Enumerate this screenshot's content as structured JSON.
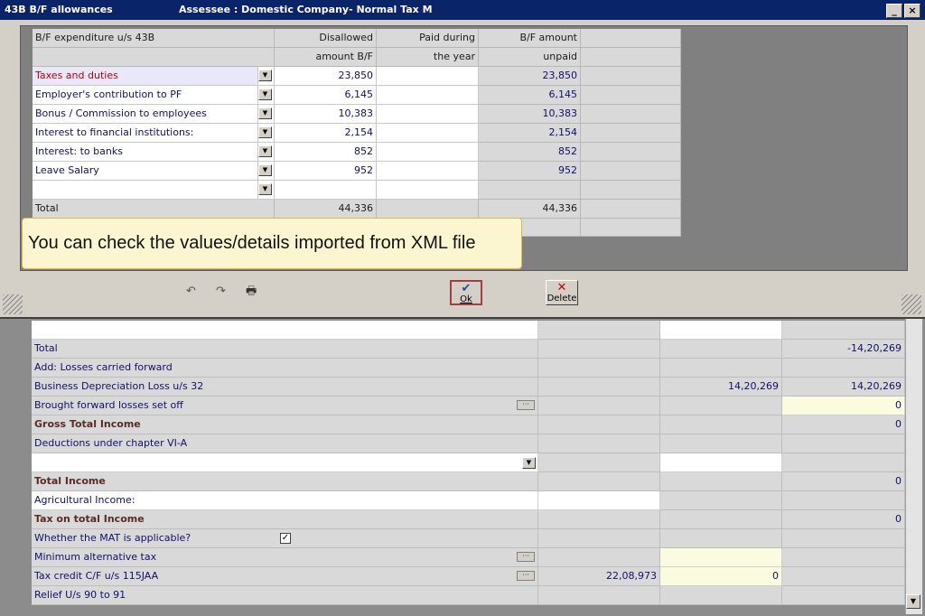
{
  "window": {
    "title": "43B B/F allowances",
    "assessee": "Assessee : Domestic Company- Normal Tax M",
    "minimize_label": "_",
    "close_label": "×"
  },
  "bf_table": {
    "headers": {
      "col1": "B/F expenditure u/s 43B",
      "col2_line1": "Disallowed",
      "col2_line2": "amount B/F",
      "col3_line1": "Paid during",
      "col3_line2": "the year",
      "col4_line1": "B/F amount",
      "col4_line2": "unpaid"
    },
    "rows": [
      {
        "label": "Taxes and duties",
        "disallowed": "23,850",
        "paid": "",
        "unpaid": "23,850"
      },
      {
        "label": "Employer's contribution to PF",
        "disallowed": "6,145",
        "paid": "",
        "unpaid": "6,145"
      },
      {
        "label": "Bonus / Commission to employees",
        "disallowed": "10,383",
        "paid": "",
        "unpaid": "10,383"
      },
      {
        "label": "Interest to financial institutions:",
        "disallowed": "2,154",
        "paid": "",
        "unpaid": "2,154"
      },
      {
        "label": "Interest: to banks",
        "disallowed": "852",
        "paid": "",
        "unpaid": "852"
      },
      {
        "label": "Leave Salary",
        "disallowed": "952",
        "paid": "",
        "unpaid": "952"
      },
      {
        "label": "",
        "disallowed": "",
        "paid": "",
        "unpaid": ""
      }
    ],
    "total": {
      "label": "Total",
      "disallowed": "44,336",
      "unpaid": "44,336"
    }
  },
  "tooltip": "You can check the values/details imported from XML file",
  "toolbar": {
    "ok_label": "Ok",
    "delete_label": "Delete"
  },
  "lower_grid": {
    "rows": [
      {
        "label": "",
        "c2": "",
        "c3": "",
        "c4": ""
      },
      {
        "label": "Total",
        "c2": "",
        "c3": "",
        "c4": "-14,20,269"
      },
      {
        "label": "Add: Losses carried forward",
        "c2": "",
        "c3": "",
        "c4": ""
      },
      {
        "label": "Business Depreciation Loss u/s 32",
        "c2": "",
        "c3": "14,20,269",
        "c4": "14,20,269"
      },
      {
        "label": "Brought forward losses set off",
        "c2": "",
        "c3": "",
        "c4": "0"
      },
      {
        "label": "Gross Total Income",
        "c2": "",
        "c3": "",
        "c4": "0"
      },
      {
        "label": "Deductions under chapter VI-A",
        "c2": "",
        "c3": "",
        "c4": ""
      },
      {
        "label": "",
        "c2": "",
        "c3": "",
        "c4": ""
      },
      {
        "label": "Total Income",
        "c2": "",
        "c3": "",
        "c4": "0"
      },
      {
        "label": "Agricultural Income:",
        "c2": "",
        "c3": "",
        "c4": ""
      },
      {
        "label": "Tax on total Income",
        "c2": "",
        "c3": "",
        "c4": "0"
      },
      {
        "label": "Whether the MAT is applicable?",
        "c2": "",
        "c3": "",
        "c4": ""
      },
      {
        "label": "Minimum alternative tax",
        "c2": "",
        "c3": "",
        "c4": ""
      },
      {
        "label": "Tax credit C/F u/s 115JAA",
        "c2": "22,08,973",
        "c3": "0",
        "c4": ""
      },
      {
        "label": "Relief U/s 90 to 91",
        "c2": "",
        "c3": "",
        "c4": ""
      }
    ],
    "mat_checked": "✓",
    "ellipsis": "···"
  }
}
